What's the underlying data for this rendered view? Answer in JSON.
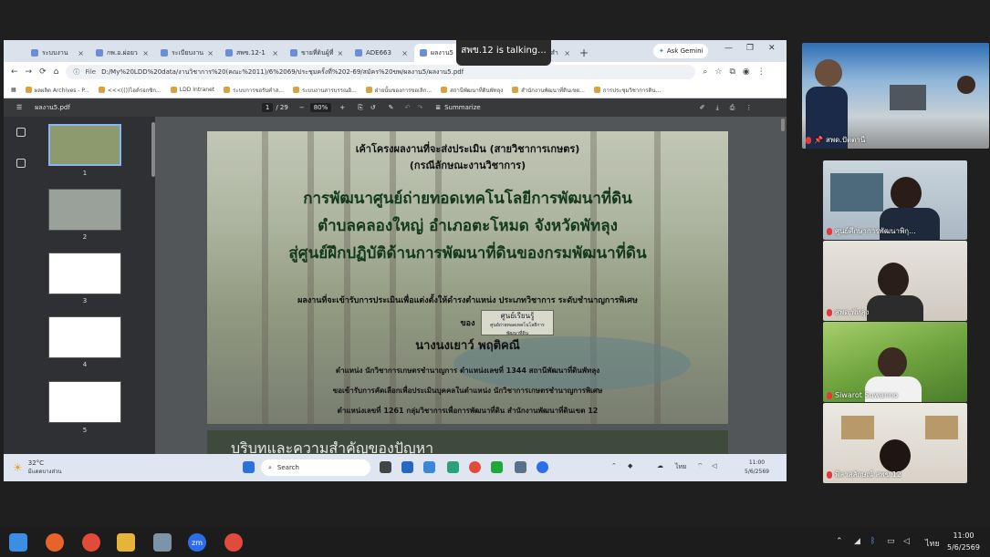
{
  "browser": {
    "tabs": [
      "ระบบงาน",
      "กพ.อ.ผ่อยว",
      "ระเบียบงาน",
      "สพข.12-1",
      "ขายที่ดินผู้ที่",
      "ADE663",
      "ผลงาน5",
      "ประกาศสำ"
    ],
    "active_tab_index": 6,
    "ask_gemini": "Ask Gemini",
    "talking_toast": "สพข.12 is talking...",
    "url_label": "File",
    "url": "D:/My%20LDD%20data/งานวิชาการ%20(คณะ%2011)/6%2069/ประชุมครั้งที่%202-69/สมัคร%20ขพ/ผลงาน5/ผลงาน5.pdf",
    "bookmarks": [
      "ผลผลิต Archives - P...",
      "<<<(())ไฮด์รอกซิก...",
      "LDD Intranet",
      "ระบบการขอรับคำส...",
      "ระบบงานสารบรรณอิ...",
      "ฝ่ายนั้นของการขอเลิก...",
      "สถานีพัฒนาที่ดินพัทลุง",
      "สำนักงานพัฒนาที่ดินเขต...",
      "การประชุมวิชาการดิน..."
    ]
  },
  "pdf": {
    "filename": "ผลงาน5.pdf",
    "page_current": "1",
    "page_total": "/ 29",
    "zoom": "80%",
    "summarize": "Summarize",
    "thumbnails": [
      "1",
      "2",
      "3",
      "4",
      "5"
    ],
    "slide": {
      "header1": "เค้าโครงผลงานที่จะส่งประเมิน (สายวิชาการเกษตร)",
      "header2": "(กรณีลักษณะงานวิชาการ)",
      "title1": "การพัฒนาศูนย์ถ่ายทอดเทคโนโลยีการพัฒนาที่ดิน",
      "title2": "ตำบลคลองใหญ่ อำเภอตะโหมด จังหวัดพัทลุง",
      "title3": "สู่ศูนย์ฝึกปฏิบัติด้านการพัฒนาที่ดินของกรมพัฒนาที่ดิน",
      "line_eval": "ผลงานที่จะเข้ารับการประเมินเพื่อแต่งตั้งให้ดำรงตำแหน่ง ประเภทวิชาการ ระดับชำนาญการพิเศษ",
      "of": "ของ",
      "author": "นางนงเยาว์ พฤติคณี",
      "position": "ตำแหน่ง นักวิชาการเกษตรชำนาญการ ตำแหน่งเลขที่ 1344 สถานีพัฒนาที่ดินพัทลุง",
      "request": "ขอเข้ารับการคัดเลือกเพื่อประเมินบุคคลในตำแหน่ง นักวิชาการเกษตรชำนาญการพิเศษ",
      "position2": "ตำแหน่งเลขที่ 1261 กลุ่มวิชาการเพื่อการพัฒนาที่ดิน สำนักงานพัฒนาที่ดินเขต 12",
      "sign_title": "ศูนย์เรียนรู้",
      "sign_sub": "ศูนย์ถ่ายทอดเทคโนโลยีการพัฒนาที่ดิน"
    },
    "next_page_heading": "บริบทและความสำคัญของปัญหา"
  },
  "inner_taskbar": {
    "temperature": "32°C",
    "weather": "มีแดดบางส่วน",
    "search": "Search",
    "lang": "ไทย",
    "time": "11:00",
    "date": "5/6/2569"
  },
  "participants": [
    {
      "name": "สพด.ปัตตานี",
      "muted": true
    },
    {
      "name": "ศูนย์ศึกษาการพัฒนาพิกุ...",
      "muted": true
    },
    {
      "name": "สพด.พัทลุง",
      "muted": true
    },
    {
      "name": "Siwarot Suwanno",
      "muted": true
    },
    {
      "name": "พิลาสลักษณ์ สพข.12",
      "muted": true
    }
  ],
  "taskbar": {
    "lang": "ไทย",
    "time": "11:00",
    "date": "5/6/2569"
  },
  "colors": {
    "accent": "#8ab4f8",
    "mute": "#e03a3a"
  }
}
